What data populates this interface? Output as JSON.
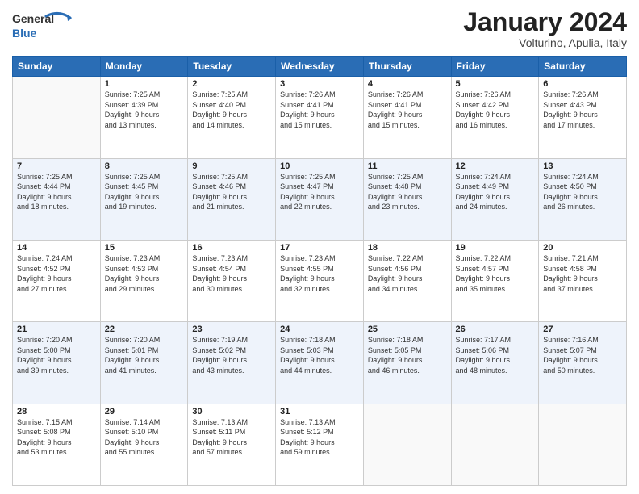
{
  "header": {
    "logo_general": "General",
    "logo_blue": "Blue",
    "month": "January 2024",
    "location": "Volturino, Apulia, Italy"
  },
  "weekdays": [
    "Sunday",
    "Monday",
    "Tuesday",
    "Wednesday",
    "Thursday",
    "Friday",
    "Saturday"
  ],
  "weeks": [
    [
      {
        "day": "",
        "info": ""
      },
      {
        "day": "1",
        "info": "Sunrise: 7:25 AM\nSunset: 4:39 PM\nDaylight: 9 hours\nand 13 minutes."
      },
      {
        "day": "2",
        "info": "Sunrise: 7:25 AM\nSunset: 4:40 PM\nDaylight: 9 hours\nand 14 minutes."
      },
      {
        "day": "3",
        "info": "Sunrise: 7:26 AM\nSunset: 4:41 PM\nDaylight: 9 hours\nand 15 minutes."
      },
      {
        "day": "4",
        "info": "Sunrise: 7:26 AM\nSunset: 4:41 PM\nDaylight: 9 hours\nand 15 minutes."
      },
      {
        "day": "5",
        "info": "Sunrise: 7:26 AM\nSunset: 4:42 PM\nDaylight: 9 hours\nand 16 minutes."
      },
      {
        "day": "6",
        "info": "Sunrise: 7:26 AM\nSunset: 4:43 PM\nDaylight: 9 hours\nand 17 minutes."
      }
    ],
    [
      {
        "day": "7",
        "info": "Sunrise: 7:25 AM\nSunset: 4:44 PM\nDaylight: 9 hours\nand 18 minutes."
      },
      {
        "day": "8",
        "info": "Sunrise: 7:25 AM\nSunset: 4:45 PM\nDaylight: 9 hours\nand 19 minutes."
      },
      {
        "day": "9",
        "info": "Sunrise: 7:25 AM\nSunset: 4:46 PM\nDaylight: 9 hours\nand 21 minutes."
      },
      {
        "day": "10",
        "info": "Sunrise: 7:25 AM\nSunset: 4:47 PM\nDaylight: 9 hours\nand 22 minutes."
      },
      {
        "day": "11",
        "info": "Sunrise: 7:25 AM\nSunset: 4:48 PM\nDaylight: 9 hours\nand 23 minutes."
      },
      {
        "day": "12",
        "info": "Sunrise: 7:24 AM\nSunset: 4:49 PM\nDaylight: 9 hours\nand 24 minutes."
      },
      {
        "day": "13",
        "info": "Sunrise: 7:24 AM\nSunset: 4:50 PM\nDaylight: 9 hours\nand 26 minutes."
      }
    ],
    [
      {
        "day": "14",
        "info": "Sunrise: 7:24 AM\nSunset: 4:52 PM\nDaylight: 9 hours\nand 27 minutes."
      },
      {
        "day": "15",
        "info": "Sunrise: 7:23 AM\nSunset: 4:53 PM\nDaylight: 9 hours\nand 29 minutes."
      },
      {
        "day": "16",
        "info": "Sunrise: 7:23 AM\nSunset: 4:54 PM\nDaylight: 9 hours\nand 30 minutes."
      },
      {
        "day": "17",
        "info": "Sunrise: 7:23 AM\nSunset: 4:55 PM\nDaylight: 9 hours\nand 32 minutes."
      },
      {
        "day": "18",
        "info": "Sunrise: 7:22 AM\nSunset: 4:56 PM\nDaylight: 9 hours\nand 34 minutes."
      },
      {
        "day": "19",
        "info": "Sunrise: 7:22 AM\nSunset: 4:57 PM\nDaylight: 9 hours\nand 35 minutes."
      },
      {
        "day": "20",
        "info": "Sunrise: 7:21 AM\nSunset: 4:58 PM\nDaylight: 9 hours\nand 37 minutes."
      }
    ],
    [
      {
        "day": "21",
        "info": "Sunrise: 7:20 AM\nSunset: 5:00 PM\nDaylight: 9 hours\nand 39 minutes."
      },
      {
        "day": "22",
        "info": "Sunrise: 7:20 AM\nSunset: 5:01 PM\nDaylight: 9 hours\nand 41 minutes."
      },
      {
        "day": "23",
        "info": "Sunrise: 7:19 AM\nSunset: 5:02 PM\nDaylight: 9 hours\nand 43 minutes."
      },
      {
        "day": "24",
        "info": "Sunrise: 7:18 AM\nSunset: 5:03 PM\nDaylight: 9 hours\nand 44 minutes."
      },
      {
        "day": "25",
        "info": "Sunrise: 7:18 AM\nSunset: 5:05 PM\nDaylight: 9 hours\nand 46 minutes."
      },
      {
        "day": "26",
        "info": "Sunrise: 7:17 AM\nSunset: 5:06 PM\nDaylight: 9 hours\nand 48 minutes."
      },
      {
        "day": "27",
        "info": "Sunrise: 7:16 AM\nSunset: 5:07 PM\nDaylight: 9 hours\nand 50 minutes."
      }
    ],
    [
      {
        "day": "28",
        "info": "Sunrise: 7:15 AM\nSunset: 5:08 PM\nDaylight: 9 hours\nand 53 minutes."
      },
      {
        "day": "29",
        "info": "Sunrise: 7:14 AM\nSunset: 5:10 PM\nDaylight: 9 hours\nand 55 minutes."
      },
      {
        "day": "30",
        "info": "Sunrise: 7:13 AM\nSunset: 5:11 PM\nDaylight: 9 hours\nand 57 minutes."
      },
      {
        "day": "31",
        "info": "Sunrise: 7:13 AM\nSunset: 5:12 PM\nDaylight: 9 hours\nand 59 minutes."
      },
      {
        "day": "",
        "info": ""
      },
      {
        "day": "",
        "info": ""
      },
      {
        "day": "",
        "info": ""
      }
    ]
  ]
}
